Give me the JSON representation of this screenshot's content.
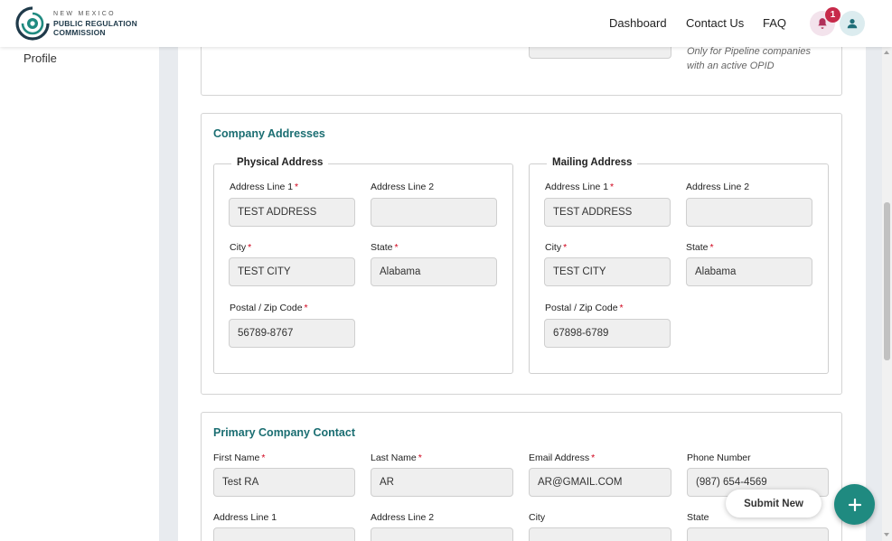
{
  "header": {
    "logo_line1": "NEW MEXICO",
    "logo_line2": "PUBLIC REGULATION",
    "logo_line3": "COMMISSION",
    "nav": {
      "dashboard": "Dashboard",
      "contact_us": "Contact Us",
      "faq": "FAQ"
    },
    "notification_count": "1"
  },
  "sidebar": {
    "profile": "Profile"
  },
  "top_card": {
    "note_line1": "Only for Pipeline companies",
    "note_line2": "with an active OPID"
  },
  "company_addresses": {
    "title": "Company Addresses",
    "physical": {
      "legend": "Physical Address",
      "address_line1_label": "Address Line 1",
      "address_line1_value": "TEST ADDRESS",
      "address_line2_label": "Address Line 2",
      "address_line2_value": "",
      "city_label": "City",
      "city_value": "TEST CITY",
      "state_label": "State",
      "state_value": "Alabama",
      "zip_label": "Postal / Zip Code",
      "zip_value": "56789-8767"
    },
    "mailing": {
      "legend": "Mailing Address",
      "address_line1_label": "Address Line 1",
      "address_line1_value": "TEST ADDRESS",
      "address_line2_label": "Address Line 2",
      "address_line2_value": "",
      "city_label": "City",
      "city_value": "TEST CITY",
      "state_label": "State",
      "state_value": "Alabama",
      "zip_label": "Postal / Zip Code",
      "zip_value": "67898-6789"
    }
  },
  "primary_contact": {
    "title": "Primary Company Contact",
    "first_name_label": "First Name",
    "first_name_value": "Test RA",
    "last_name_label": "Last Name",
    "last_name_value": "AR",
    "email_label": "Email Address",
    "email_value": "AR@GMAIL.COM",
    "phone_label": "Phone Number",
    "phone_value": "(987) 654-4569",
    "address_line1_label": "Address Line 1",
    "address_line2_label": "Address Line 2",
    "city_label": "City",
    "state_label": "State"
  },
  "actions": {
    "submit_new": "Submit New"
  },
  "colors": {
    "accent": "#1b6e72",
    "fab": "#1f8a80",
    "badge": "#c72a4a",
    "required": "#d0021b"
  }
}
